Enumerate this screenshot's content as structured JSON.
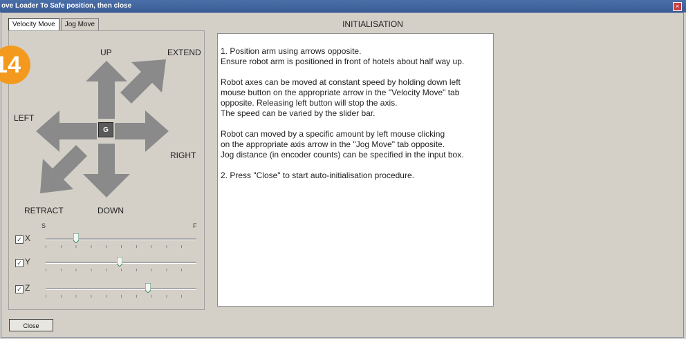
{
  "window": {
    "title": "ove Loader To Safe position, then close"
  },
  "tabs": [
    {
      "label": "Velocity Move",
      "active": true
    },
    {
      "label": "Jog Move",
      "active": false
    }
  ],
  "badge": "14",
  "directions": {
    "up": "UP",
    "extend": "EXTEND",
    "left": "LEFT",
    "right": "RIGHT",
    "retract": "RETRACT",
    "down": "DOWN",
    "center": "G"
  },
  "speed_labels": {
    "slow": "S",
    "fast": "F"
  },
  "axes": [
    {
      "label": "X",
      "checked": true,
      "level": 0.2
    },
    {
      "label": "Y",
      "checked": true,
      "level": 0.49
    },
    {
      "label": "Z",
      "checked": true,
      "level": 0.68
    }
  ],
  "heading": "INITIALISATION",
  "instructions": [
    "1. Position arm using arrows opposite.\nEnsure robot arm is positioned in front of hotels about half way up.",
    "Robot axes can be moved at constant speed by holding down left\nmouse button on the appropriate arrow in the \"Velocity Move\" tab\nopposite. Releasing left button will stop the axis.\nThe speed can be varied by the slider bar.",
    "Robot can moved by a specific amount by left mouse clicking\non the appropriate axis arrow in the \"Jog Move\" tab opposite.\nJog distance (in encoder counts) can be specified in the input box.",
    "2. Press \"Close\" to start auto-initialisation procedure."
  ],
  "close_button": "Close",
  "colors": {
    "arrow": "#8a8a8a",
    "badge": "#f39a1e",
    "titlebar": "#3b5d96"
  }
}
